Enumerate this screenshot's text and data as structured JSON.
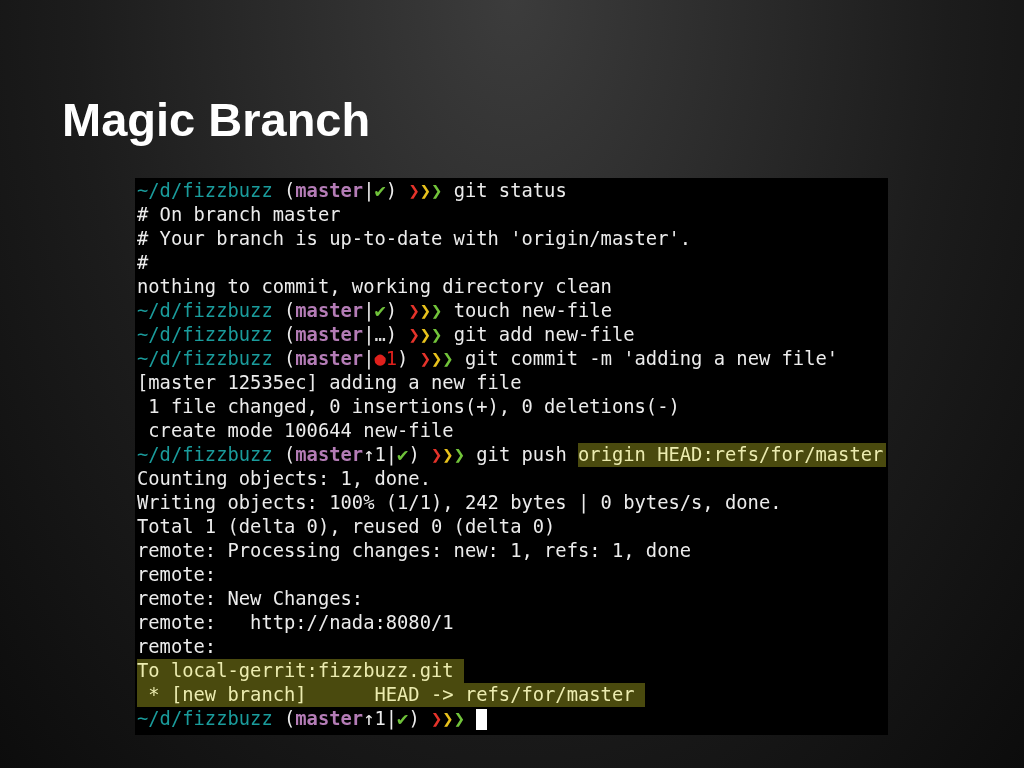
{
  "slide": {
    "title": "Magic Branch"
  },
  "terminal": {
    "lines": [
      {
        "kind": "prompt",
        "path": "~/d/fizzbuzz",
        "open": "(",
        "branch": "master",
        "sep": "|",
        "status": {
          "text": "✔",
          "color": "#6fc23a"
        },
        "close": ")",
        "arrows": "❯❯❯",
        "command": "git status"
      },
      {
        "kind": "output",
        "text": "# On branch master",
        "highlighted": false
      },
      {
        "kind": "output",
        "text": "# Your branch is up-to-date with 'origin/master'.",
        "highlighted": false
      },
      {
        "kind": "output",
        "text": "#",
        "highlighted": false
      },
      {
        "kind": "output",
        "text": "nothing to commit, working directory clean",
        "highlighted": false
      },
      {
        "kind": "prompt",
        "path": "~/d/fizzbuzz",
        "open": "(",
        "branch": "master",
        "sep": "|",
        "status": {
          "text": "✔",
          "color": "#6fc23a"
        },
        "close": ")",
        "arrows": "❯❯❯",
        "command": "touch new-file"
      },
      {
        "kind": "prompt",
        "path": "~/d/fizzbuzz",
        "open": "(",
        "branch": "master",
        "sep": "|",
        "status": {
          "text": "…",
          "color": "#d8d8d8"
        },
        "close": ")",
        "arrows": "❯❯❯",
        "command": "git add new-file"
      },
      {
        "kind": "prompt",
        "path": "~/d/fizzbuzz",
        "open": "(",
        "branch": "master",
        "sep": "|",
        "status": {
          "text": "●1",
          "color": "#e0201c"
        },
        "close": ")",
        "arrows": "❯❯❯",
        "command": "git commit -m 'adding a new file'"
      },
      {
        "kind": "output",
        "text": "[master 12535ec] adding a new file",
        "highlighted": false
      },
      {
        "kind": "output",
        "text": " 1 file changed, 0 insertions(+), 0 deletions(-)",
        "highlighted": false
      },
      {
        "kind": "output",
        "text": " create mode 100644 new-file",
        "highlighted": false
      },
      {
        "kind": "prompt",
        "path": "~/d/fizzbuzz",
        "open": "(",
        "branch": "master",
        "ahead": "↑1",
        "sep": "|",
        "status": {
          "text": "✔",
          "color": "#6fc23a"
        },
        "close": ")",
        "arrows": "❯❯❯",
        "command": "git push",
        "highlight": "origin HEAD:refs/for/master"
      },
      {
        "kind": "output",
        "text": "Counting objects: 1, done.",
        "highlighted": false
      },
      {
        "kind": "output",
        "text": "Writing objects: 100% (1/1), 242 bytes | 0 bytes/s, done.",
        "highlighted": false
      },
      {
        "kind": "output",
        "text": "Total 1 (delta 0), reused 0 (delta 0)",
        "highlighted": false
      },
      {
        "kind": "output",
        "text": "remote: Processing changes: new: 1, refs: 1, done",
        "highlighted": false
      },
      {
        "kind": "output",
        "text": "remote:",
        "highlighted": false
      },
      {
        "kind": "output",
        "text": "remote: New Changes:",
        "highlighted": false
      },
      {
        "kind": "output",
        "text": "remote:   http://nada:8080/1",
        "highlighted": false
      },
      {
        "kind": "output",
        "text": "remote:",
        "highlighted": false
      },
      {
        "kind": "output",
        "text": "To local-gerrit:fizzbuzz.git",
        "highlighted": true
      },
      {
        "kind": "output",
        "text": " * [new branch]      HEAD -> refs/for/master",
        "highlighted": true
      },
      {
        "kind": "prompt",
        "path": "~/d/fizzbuzz",
        "open": "(",
        "branch": "master",
        "ahead": "↑1",
        "sep": "|",
        "status": {
          "text": "✔",
          "color": "#6fc23a"
        },
        "close": ")",
        "arrows": "❯❯❯",
        "cursor": true
      }
    ]
  }
}
